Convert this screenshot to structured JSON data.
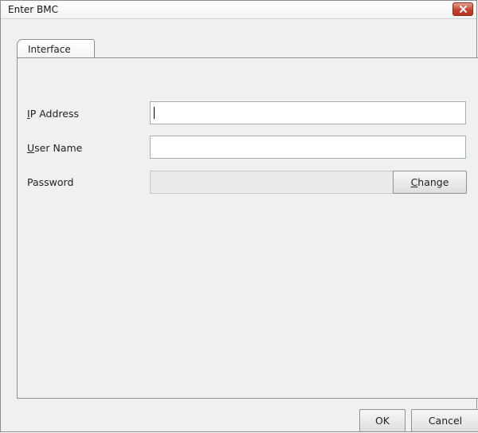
{
  "window": {
    "title": "Enter BMC",
    "close_icon": "close-icon"
  },
  "tabs": [
    {
      "label": "Interface",
      "selected": true
    }
  ],
  "form": {
    "ip_address": {
      "label_mnemonic": "I",
      "label_rest": "P Address",
      "value": ""
    },
    "user_name": {
      "label_mnemonic": "U",
      "label_rest": "ser Name",
      "value": ""
    },
    "password": {
      "label": "Password",
      "value": "",
      "change_mnemonic": "C",
      "change_rest": "hange"
    }
  },
  "buttons": {
    "ok": "OK",
    "cancel": "Cancel"
  },
  "colors": {
    "close_button": "#c7432f",
    "window_bg": "#f0f0f0"
  }
}
